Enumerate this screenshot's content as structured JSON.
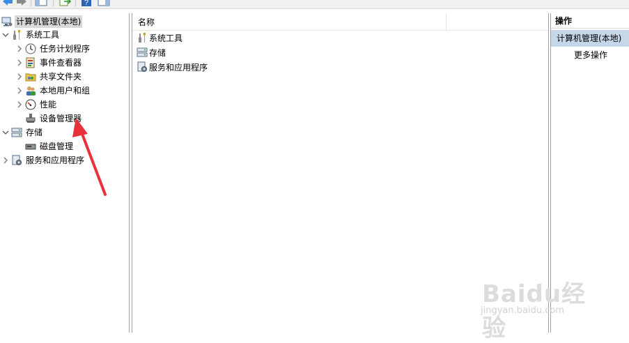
{
  "toolbar": {
    "buttons": [
      "back-icon",
      "forward-icon",
      "show-hide-tree-icon",
      "export-list-icon",
      "help-icon",
      "show-hide-action-pane-icon"
    ]
  },
  "tree": {
    "root": "计算机管理(本地)",
    "system_tools": "系统工具",
    "task_scheduler": "任务计划程序",
    "event_viewer": "事件查看器",
    "shared_folders": "共享文件夹",
    "local_users": "本地用户和组",
    "performance": "性能",
    "device_manager": "设备管理器",
    "storage": "存储",
    "disk_management": "磁盘管理",
    "services_apps": "服务和应用程序"
  },
  "main": {
    "column_name": "名称",
    "items": [
      "系统工具",
      "存储",
      "服务和应用程序"
    ]
  },
  "actions": {
    "header": "操作",
    "section": "计算机管理(本地)",
    "more": "更多操作"
  },
  "watermark": {
    "brand": "Baidu经验",
    "url": "jingyan.baidu.com"
  },
  "colors": {
    "selection": "#d9d9d9",
    "action_section_bg": "#c7d7ea",
    "annotation_arrow": "#e8313b",
    "pane_border": "#a0a0a0"
  }
}
